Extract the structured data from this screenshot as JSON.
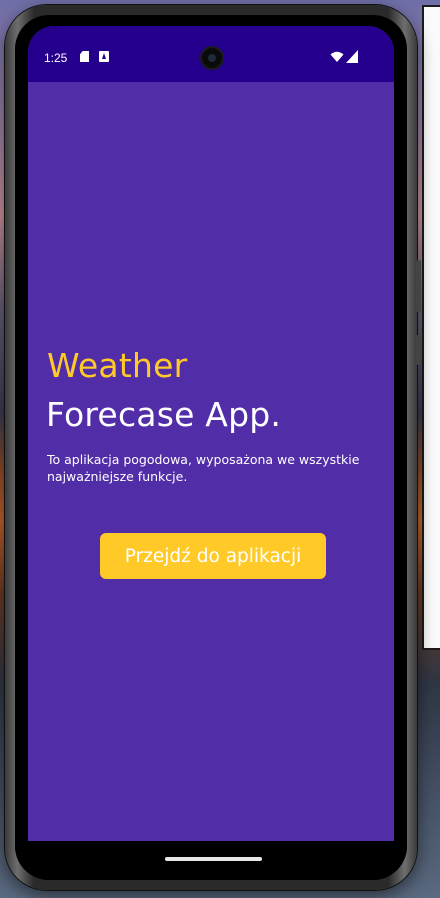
{
  "status_bar": {
    "time": "1:25",
    "icons": [
      "sd-card-icon",
      "a-notification-icon",
      "wifi-icon",
      "signal-icon"
    ]
  },
  "app": {
    "title_line1": "Weather",
    "title_line2": "Forecase App.",
    "description": "To aplikacja pogodowa, wyposażona we wszystkie najważniejsze funkcje.",
    "cta_label": "Przejdź do aplikacji"
  },
  "colors": {
    "status_bar_bg": "#25008c",
    "screen_bg": "#512da8",
    "accent": "#ffca28",
    "text": "#ffffff"
  }
}
